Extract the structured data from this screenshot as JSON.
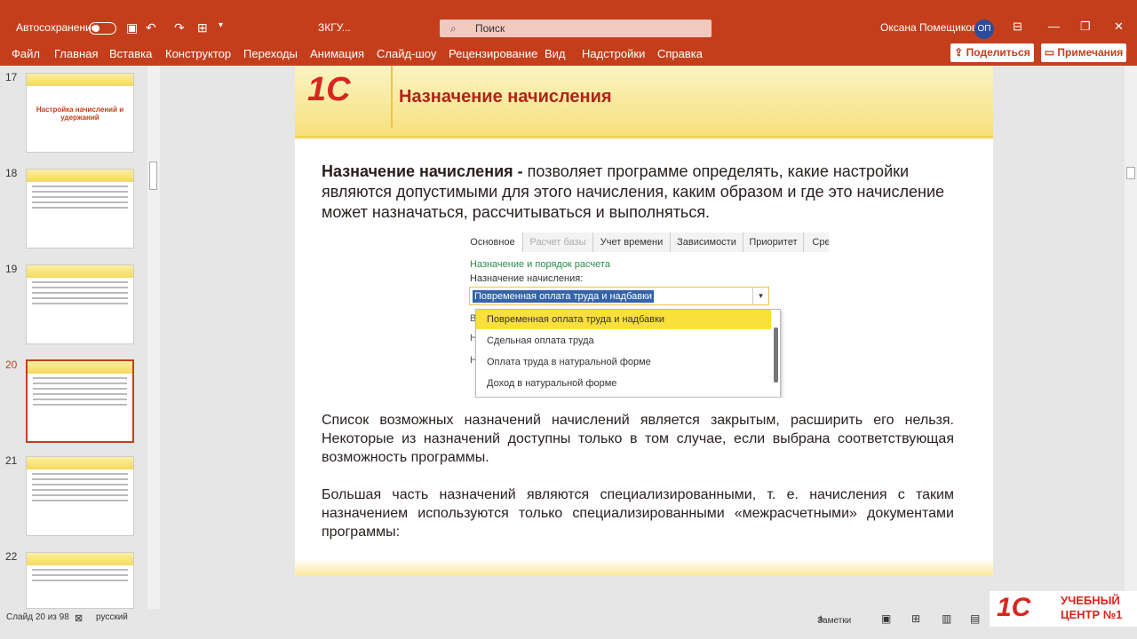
{
  "titlebar": {
    "autosave_label": "Автосохранение",
    "doc_title": "ЗКГУ...",
    "search_placeholder": "Поиск",
    "user_name": "Оксана Помещикова",
    "user_initials": "ОП",
    "qat_icons": [
      "save-icon",
      "undo-icon",
      "redo-icon",
      "present-icon",
      "customize-icon"
    ]
  },
  "menu": [
    "Файл",
    "Главная",
    "Вставка",
    "Конструктор",
    "Переходы",
    "Анимация",
    "Слайд-шоу",
    "Рецензирование",
    "Вид",
    "Надстройки",
    "Справка"
  ],
  "share_label": "Поделиться",
  "comments_label": "Примечания",
  "thumbnails": [
    {
      "num": "17",
      "title": "Настройка начислений и удержаний"
    },
    {
      "num": "18",
      "title": ""
    },
    {
      "num": "19",
      "title": ""
    },
    {
      "num": "20",
      "title": ""
    },
    {
      "num": "21",
      "title": ""
    },
    {
      "num": "22",
      "title": ""
    }
  ],
  "slide": {
    "logo": "1С",
    "title": "Назначение начисления",
    "intro_bold": "Назначение начисления -",
    "intro_text": " позволяет программе определять, какие настройки являются допустимыми для этого начисления, каким образом и где это начисление может назначаться, рассчитываться и выполняться.",
    "para1": "Список возможных назначений начислений является закрытым, расширить его нельзя. Некоторые из назначений доступны только в том случае, если выбрана соответствующая возможность программы.",
    "para2": "Большая часть назначений являются специализированными, т. е. начисления с таким назначением используются только специализированными «межрасчетными» документами программы:"
  },
  "form": {
    "tabs": [
      "Основное",
      "Расчет базы",
      "Учет времени",
      "Зависимости",
      "Приоритет",
      "Сре"
    ],
    "group_label": "Назначение и порядок расчета",
    "field_label": "Назначение начисления:",
    "selected_value": "Повременная оплата труда и надбавки",
    "options": [
      "Повременная оплата труда и надбавки",
      "Сдельная оплата труда",
      "Оплата труда в натуральной форме",
      "Доход в натуральной форме"
    ]
  },
  "status": {
    "slide_counter": "Слайд 20 из 98",
    "language": "русский",
    "notes_label": "Заметки"
  },
  "watermark": {
    "logo": "1С",
    "line1": "УЧЕБНЫЙ",
    "line2": "ЦЕНТР №1"
  },
  "colors": {
    "accent": "#c43e1c",
    "slide_title": "#b02418",
    "highlight": "#fbdf3a"
  }
}
